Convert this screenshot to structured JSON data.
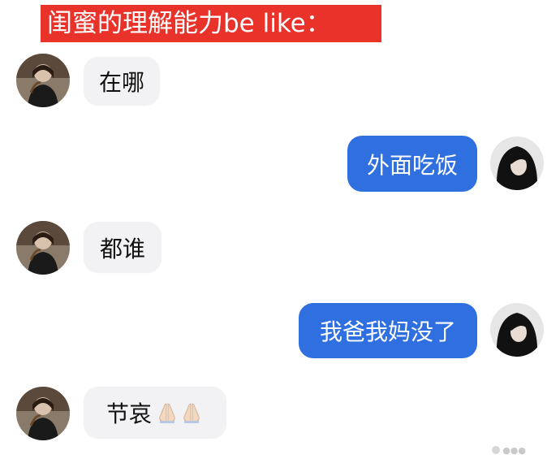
{
  "title": "闺蜜的理解能力be like：",
  "messages": [
    {
      "side": "left",
      "text": "在哪",
      "avatar_icon": "friend-avatar"
    },
    {
      "side": "right",
      "text": "外面吃饭",
      "avatar_icon": "self-avatar"
    },
    {
      "side": "left",
      "text": "都谁",
      "avatar_icon": "friend-avatar"
    },
    {
      "side": "right",
      "text": "我爸我妈没了",
      "avatar_icon": "self-avatar"
    },
    {
      "side": "left",
      "text": "节哀",
      "avatar_icon": "friend-avatar",
      "emoji": [
        "praying-hands-icon",
        "praying-hands-icon"
      ]
    }
  ],
  "colors": {
    "banner": "#e8322a",
    "right_bubble": "#2f6fe0",
    "left_bubble": "#f2f2f4"
  }
}
